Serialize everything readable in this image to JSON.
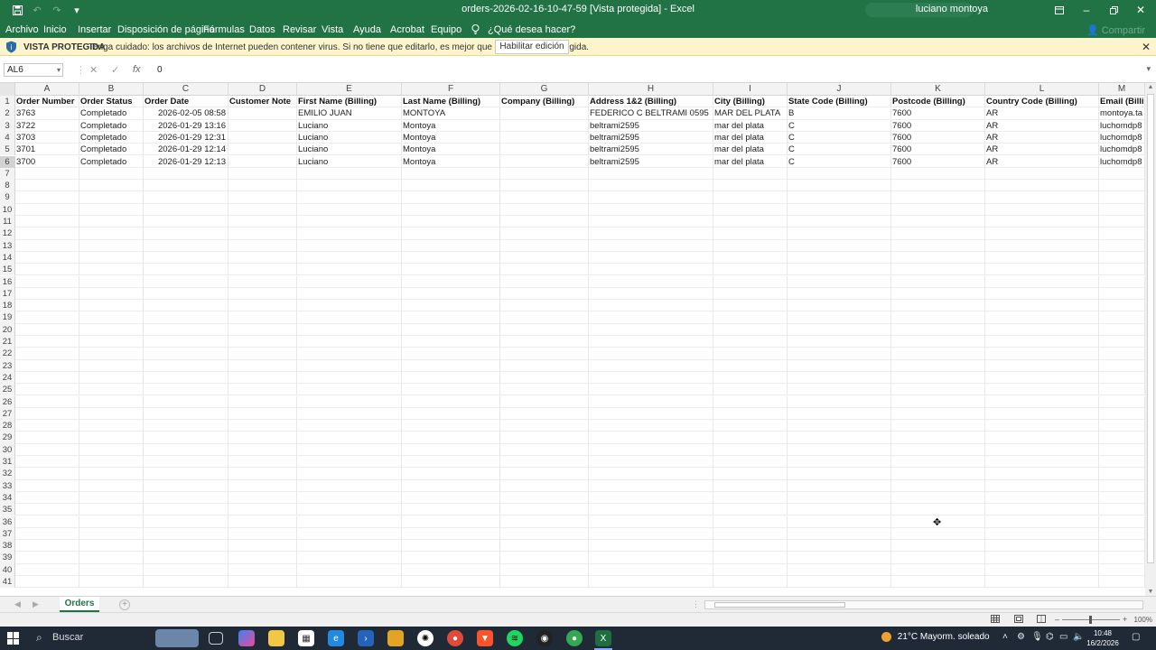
{
  "window": {
    "title": "orders-2026-02-16-10-47-59 [Vista protegida] - Excel",
    "user": "luciano montoya"
  },
  "ribbon": {
    "tabs": [
      "Archivo",
      "Inicio",
      "Insertar",
      "Disposición de página",
      "Fórmulas",
      "Datos",
      "Revisar",
      "Vista",
      "Ayuda",
      "Acrobat",
      "Equipo"
    ],
    "tell_me": "¿Qué desea hacer?",
    "share": "Compartir"
  },
  "protected_view": {
    "label": "VISTA PROTEGIDA",
    "message": "Tenga cuidado: los archivos de Internet pueden contener virus. Si no tiene que editarlo, es mejor que siga en Vista protegida.",
    "enable_button": "Habilitar edición"
  },
  "formula_bar": {
    "name_box": "AL6",
    "cancel": "✕",
    "enter": "✓",
    "fx": "fx",
    "value": "0"
  },
  "sheet": {
    "columns": [
      "A",
      "B",
      "C",
      "D",
      "E",
      "F",
      "G",
      "H",
      "I",
      "J",
      "K",
      "L",
      "M"
    ],
    "headers": [
      "Order Number",
      "Order Status",
      "Order Date",
      "Customer Note",
      "First Name (Billing)",
      "Last Name (Billing)",
      "Company (Billing)",
      "Address 1&2 (Billing)",
      "City (Billing)",
      "State Code (Billing)",
      "Postcode (Billing)",
      "Country Code (Billing)",
      "Email (Billi"
    ],
    "rows": [
      [
        "3763",
        "Completado",
        "2026-02-05 08:58",
        "",
        "EMILIO JUAN",
        "MONTOYA",
        "",
        "FEDERICO C BELTRAMI 0595",
        "MAR DEL PLATA",
        "B",
        "7600",
        "AR",
        "montoya.ta"
      ],
      [
        "3722",
        "Completado",
        "2026-01-29 13:16",
        "",
        "Luciano",
        "Montoya",
        "",
        "beltrami2595",
        "mar del plata",
        "C",
        "7600",
        "AR",
        "luchomdp8"
      ],
      [
        "3703",
        "Completado",
        "2026-01-29 12:31",
        "",
        "Luciano",
        "Montoya",
        "",
        "beltrami2595",
        "mar del plata",
        "C",
        "7600",
        "AR",
        "luchomdp8"
      ],
      [
        "3701",
        "Completado",
        "2026-01-29 12:14",
        "",
        "Luciano",
        "Montoya",
        "",
        "beltrami2595",
        "mar del plata",
        "C",
        "7600",
        "AR",
        "luchomdp8"
      ],
      [
        "3700",
        "Completado",
        "2026-01-29 12:13",
        "",
        "Luciano",
        "Montoya",
        "",
        "beltrami2595",
        "mar del plata",
        "C",
        "7600",
        "AR",
        "luchomdp8"
      ]
    ],
    "total_rows_visible": 41,
    "tab_name": "Orders"
  },
  "status_bar": {
    "zoom": "100%"
  },
  "taskbar": {
    "search_placeholder": "Buscar",
    "weather": "21°C  Mayorm. soleado",
    "time": "10:48",
    "date": "16/2/2026"
  },
  "colors": {
    "excel_green": "#217346",
    "protected_bar": "#fcf4cc",
    "taskbar": "#1f2a36"
  }
}
